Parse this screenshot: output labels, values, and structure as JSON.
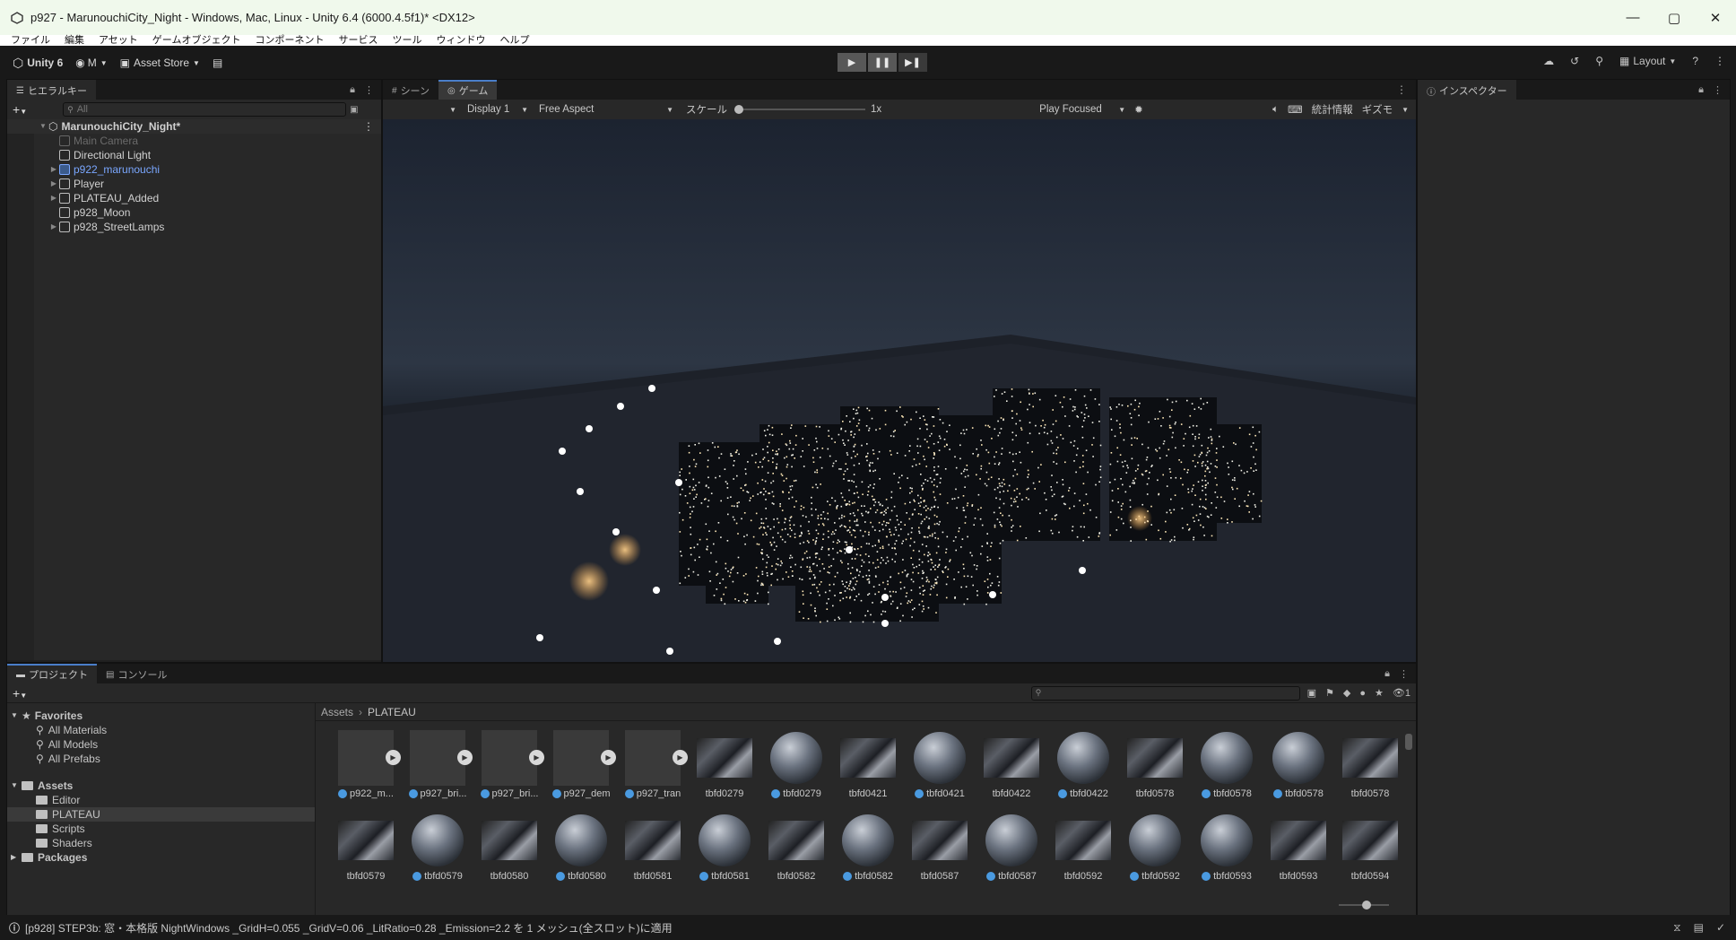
{
  "window": {
    "title": "p927 - MarunouchiCity_Night - Windows, Mac, Linux - Unity 6.4 (6000.4.5f1)* <DX12>",
    "minimize_glyph": "—",
    "maximize_glyph": "▢",
    "close_glyph": "✕"
  },
  "menu": [
    "ファイル",
    "編集",
    "アセット",
    "ゲームオブジェクト",
    "コンポーネント",
    "サービス",
    "ツール",
    "ウィンドウ",
    "ヘルプ"
  ],
  "toolbar": {
    "unity_label": "Unity 6",
    "account_label": "M",
    "asset_store_label": "Asset Store",
    "layout_label": "Layout",
    "play_glyph": "▶",
    "pause_glyph": "❚❚",
    "step_glyph": "▶❚"
  },
  "hierarchy": {
    "tab_label": "ヒエラルキー",
    "search_placeholder": "All",
    "scene_name": "MarunouchiCity_Night*",
    "items": [
      {
        "label": "Main Camera",
        "state": "disabled",
        "expandable": false
      },
      {
        "label": "Directional Light",
        "state": "normal",
        "expandable": false
      },
      {
        "label": "p922_marunouchi",
        "state": "prefab",
        "expandable": true
      },
      {
        "label": "Player",
        "state": "normal",
        "expandable": true
      },
      {
        "label": "PLATEAU_Added",
        "state": "normal",
        "expandable": true
      },
      {
        "label": "p928_Moon",
        "state": "normal",
        "expandable": false
      },
      {
        "label": "p928_StreetLamps",
        "state": "normal",
        "expandable": true
      }
    ]
  },
  "game_view": {
    "scene_tab": "シーン",
    "game_tab": "ゲーム",
    "display_label": "Display 1",
    "aspect_label": "Free Aspect",
    "scale_label": "スケール",
    "scale_value": "1x",
    "play_mode_label": "Play Focused",
    "stats_label": "統計情報",
    "gizmos_label": "ギズモ"
  },
  "inspector": {
    "tab_label": "インスペクター"
  },
  "project": {
    "project_tab": "プロジェクト",
    "console_tab": "コンソール",
    "favorites_label": "Favorites",
    "favorites": [
      "All Materials",
      "All Models",
      "All Prefabs"
    ],
    "assets_label": "Assets",
    "asset_folders": [
      "Editor",
      "PLATEAU",
      "Scripts",
      "Shaders"
    ],
    "packages_label": "Packages",
    "breadcrumb_root": "Assets",
    "breadcrumb_current": "PLATEAU",
    "hidden_count": "1",
    "assets_row1": [
      {
        "label": "p922_m...",
        "kind": "prefab-model"
      },
      {
        "label": "p927_bri...",
        "kind": "prefab-model"
      },
      {
        "label": "p927_bri...",
        "kind": "prefab-model"
      },
      {
        "label": "p927_dem",
        "kind": "prefab-model"
      },
      {
        "label": "p927_tran",
        "kind": "prefab-model"
      },
      {
        "label": "tbfd0279",
        "kind": "texture"
      },
      {
        "label": "tbfd0279",
        "kind": "material"
      },
      {
        "label": "tbfd0421",
        "kind": "texture"
      },
      {
        "label": "tbfd0421",
        "kind": "material"
      },
      {
        "label": "tbfd0422",
        "kind": "texture"
      },
      {
        "label": "tbfd0422",
        "kind": "material"
      },
      {
        "label": "tbfd0578",
        "kind": "texture"
      },
      {
        "label": "tbfd0578",
        "kind": "material"
      },
      {
        "label": "tbfd0578",
        "kind": "material"
      },
      {
        "label": "tbfd0578",
        "kind": "texture"
      }
    ],
    "assets_row2": [
      {
        "label": "tbfd0579",
        "kind": "texture"
      },
      {
        "label": "tbfd0579",
        "kind": "material"
      },
      {
        "label": "tbfd0580",
        "kind": "texture"
      },
      {
        "label": "tbfd0580",
        "kind": "material"
      },
      {
        "label": "tbfd0581",
        "kind": "texture"
      },
      {
        "label": "tbfd0581",
        "kind": "material"
      },
      {
        "label": "tbfd0582",
        "kind": "texture"
      },
      {
        "label": "tbfd0582",
        "kind": "material"
      },
      {
        "label": "tbfd0587",
        "kind": "texture"
      },
      {
        "label": "tbfd0587",
        "kind": "material"
      },
      {
        "label": "tbfd0592",
        "kind": "texture"
      },
      {
        "label": "tbfd0592",
        "kind": "material"
      },
      {
        "label": "tbfd0593",
        "kind": "material"
      },
      {
        "label": "tbfd0593",
        "kind": "texture"
      },
      {
        "label": "tbfd0594",
        "kind": "texture"
      }
    ]
  },
  "status": {
    "message": "[p928] STEP3b: 窓・本格版 NightWindows _GridH=0.055 _GridV=0.06 _LitRatio=0.28 _Emission=2.2 を 1 メッシュ(全スロット)に適用"
  },
  "colors": {
    "accent": "#4a7ec9",
    "prefab_text": "#7aa7ff",
    "panel": "#202020",
    "toolbar": "#191919"
  }
}
